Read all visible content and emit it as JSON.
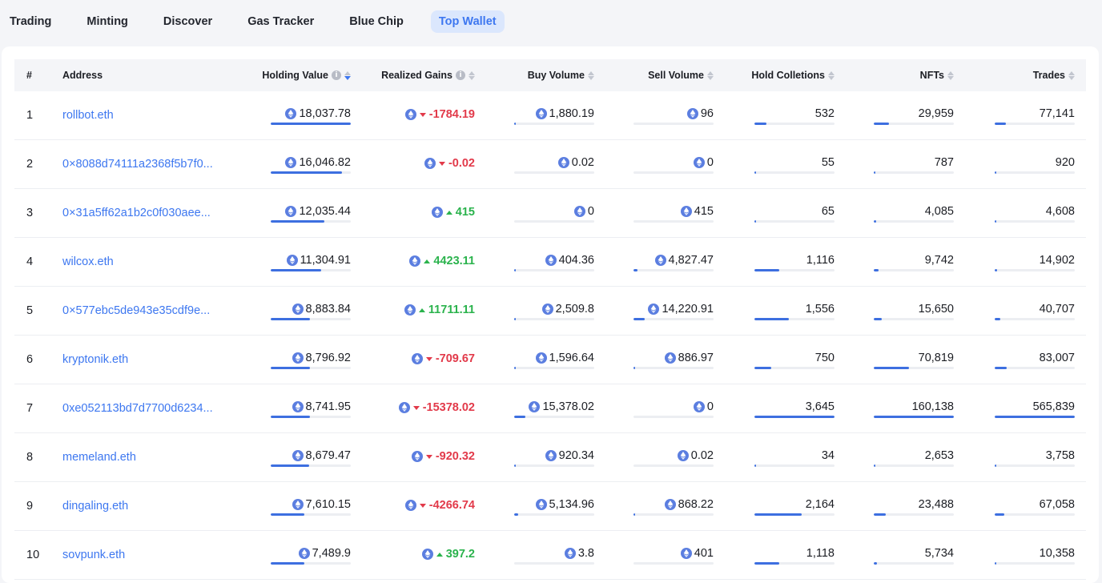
{
  "tabs": [
    {
      "label": "Trading",
      "active": false
    },
    {
      "label": "Minting",
      "active": false
    },
    {
      "label": "Discover",
      "active": false
    },
    {
      "label": "Gas Tracker",
      "active": false
    },
    {
      "label": "Blue Chip",
      "active": false
    },
    {
      "label": "Top Wallet",
      "active": true
    }
  ],
  "table": {
    "headers": {
      "rank": "#",
      "address": "Address",
      "holding_value": "Holding Value",
      "realized_gains": "Realized Gains",
      "buy_volume": "Buy Volume",
      "sell_volume": "Sell Volume",
      "hold_collections": "Hold Colletions",
      "nfts": "NFTs",
      "trades": "Trades"
    },
    "colors": {
      "accent": "#3d77f0",
      "negative": "#e23a4a",
      "positive": "#2bb34d",
      "bar": "#3d6fe0"
    },
    "rows": [
      {
        "rank": "1",
        "address": "rollbot.eth",
        "holding": "18,037.78",
        "gain": "-1784.19",
        "gain_dir": "down",
        "buy": "1,880.19",
        "sell": "96",
        "collections": "532",
        "nfts": "29,959",
        "trades": "77,141",
        "fills": {
          "holding": 1.0,
          "buy": 0.02,
          "sell": 0.0,
          "collections": 0.146,
          "nfts": 0.187,
          "trades": 0.136
        }
      },
      {
        "rank": "2",
        "address": "0×8088d74111a2368f5b7f0...",
        "holding": "16,046.82",
        "gain": "-0.02",
        "gain_dir": "down",
        "buy": "0.02",
        "sell": "0",
        "collections": "55",
        "nfts": "787",
        "trades": "920",
        "fills": {
          "holding": 0.89,
          "buy": 0.0,
          "sell": 0.0,
          "collections": 0.015,
          "nfts": 0.005,
          "trades": 0.002
        }
      },
      {
        "rank": "3",
        "address": "0×31a5ff62a1b2c0f030aee...",
        "holding": "12,035.44",
        "gain": "415",
        "gain_dir": "up",
        "buy": "0",
        "sell": "415",
        "collections": "65",
        "nfts": "4,085",
        "trades": "4,608",
        "fills": {
          "holding": 0.667,
          "buy": 0.0,
          "sell": 0.0,
          "collections": 0.018,
          "nfts": 0.026,
          "trades": 0.008
        }
      },
      {
        "rank": "4",
        "address": "wilcox.eth",
        "holding": "11,304.91",
        "gain": "4423.11",
        "gain_dir": "up",
        "buy": "404.36",
        "sell": "4,827.47",
        "collections": "1,116",
        "nfts": "9,742",
        "trades": "14,902",
        "fills": {
          "holding": 0.627,
          "buy": 0.005,
          "sell": 0.05,
          "collections": 0.306,
          "nfts": 0.061,
          "trades": 0.026
        }
      },
      {
        "rank": "5",
        "address": "0×577ebc5de943e35cdf9e...",
        "holding": "8,883.84",
        "gain": "11711.11",
        "gain_dir": "up",
        "buy": "2,509.8",
        "sell": "14,220.91",
        "collections": "1,556",
        "nfts": "15,650",
        "trades": "40,707",
        "fills": {
          "holding": 0.493,
          "buy": 0.02,
          "sell": 0.14,
          "collections": 0.427,
          "nfts": 0.098,
          "trades": 0.072
        }
      },
      {
        "rank": "6",
        "address": "kryptonik.eth",
        "holding": "8,796.92",
        "gain": "-709.67",
        "gain_dir": "down",
        "buy": "1,596.64",
        "sell": "886.97",
        "collections": "750",
        "nfts": "70,819",
        "trades": "83,007",
        "fills": {
          "holding": 0.488,
          "buy": 0.02,
          "sell": 0.01,
          "collections": 0.206,
          "nfts": 0.442,
          "trades": 0.147
        }
      },
      {
        "rank": "7",
        "address": "0xe052113bd7d7700d6234...",
        "holding": "8,741.95",
        "gain": "-15378.02",
        "gain_dir": "down",
        "buy": "15,378.02",
        "sell": "0",
        "collections": "3,645",
        "nfts": "160,138",
        "trades": "565,839",
        "fills": {
          "holding": 0.485,
          "buy": 0.14,
          "sell": 0.0,
          "collections": 1.0,
          "nfts": 1.0,
          "trades": 1.0
        }
      },
      {
        "rank": "8",
        "address": "memeland.eth",
        "holding": "8,679.47",
        "gain": "-920.32",
        "gain_dir": "down",
        "buy": "920.34",
        "sell": "0.02",
        "collections": "34",
        "nfts": "2,653",
        "trades": "3,758",
        "fills": {
          "holding": 0.481,
          "buy": 0.01,
          "sell": 0.0,
          "collections": 0.009,
          "nfts": 0.017,
          "trades": 0.007
        }
      },
      {
        "rank": "9",
        "address": "dingaling.eth",
        "holding": "7,610.15",
        "gain": "-4266.74",
        "gain_dir": "down",
        "buy": "5,134.96",
        "sell": "868.22",
        "collections": "2,164",
        "nfts": "23,488",
        "trades": "67,058",
        "fills": {
          "holding": 0.422,
          "buy": 0.05,
          "sell": 0.01,
          "collections": 0.594,
          "nfts": 0.147,
          "trades": 0.119
        }
      },
      {
        "rank": "10",
        "address": "sovpunk.eth",
        "holding": "7,489.9",
        "gain": "397.2",
        "gain_dir": "up",
        "buy": "3.8",
        "sell": "401",
        "collections": "1,118",
        "nfts": "5,734",
        "trades": "10,358",
        "fills": {
          "holding": 0.415,
          "buy": 0.0,
          "sell": 0.0,
          "collections": 0.307,
          "nfts": 0.036,
          "trades": 0.018
        }
      }
    ]
  }
}
